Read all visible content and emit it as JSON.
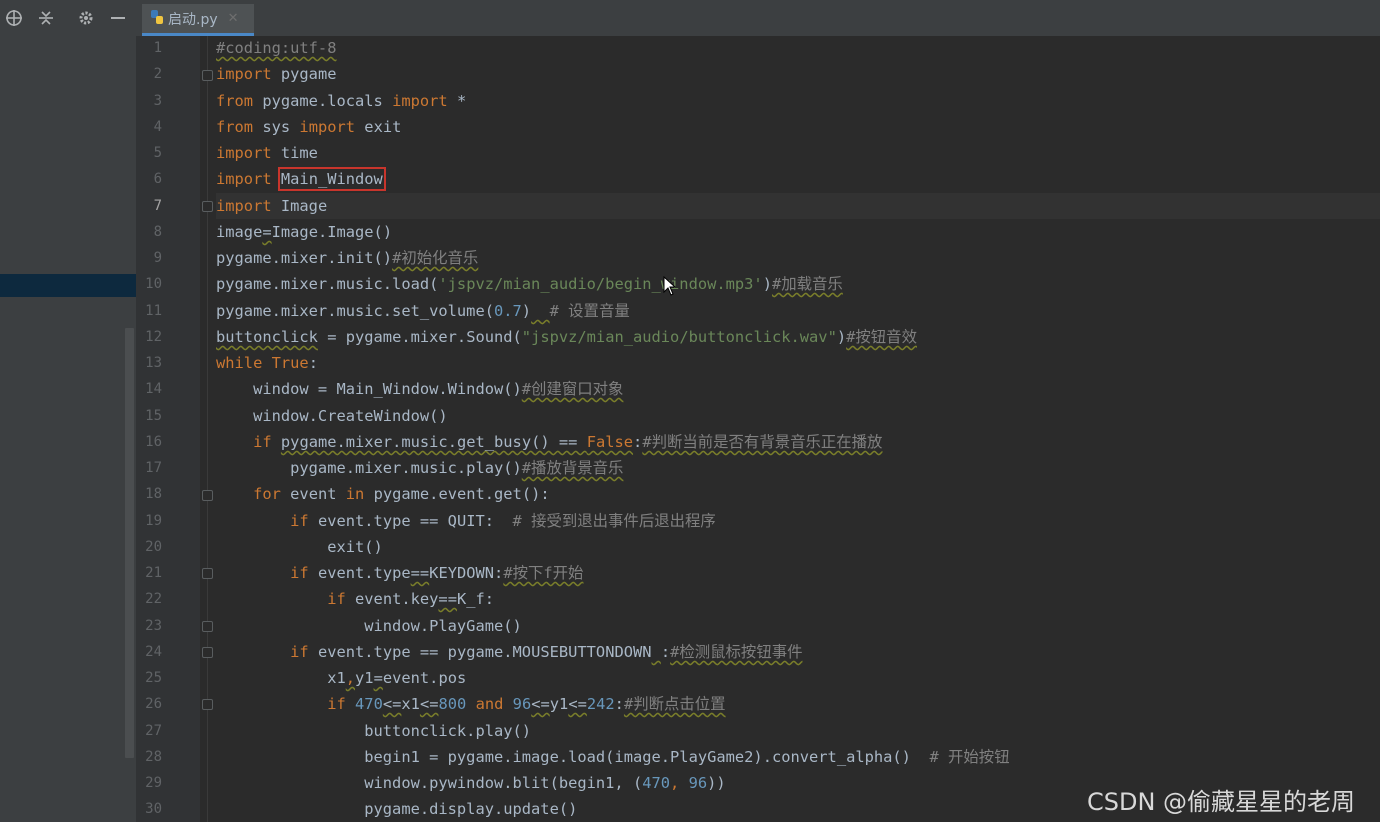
{
  "tab": {
    "filename": "启动.py"
  },
  "sidebar": {
    "icons": [
      "target-icon",
      "collapse-icon",
      "gear-icon",
      "minimize-icon"
    ]
  },
  "editor": {
    "current_line": 7,
    "lines": [
      {
        "n": "1"
      },
      {
        "n": "2"
      },
      {
        "n": "3"
      },
      {
        "n": "4"
      },
      {
        "n": "5"
      },
      {
        "n": "6"
      },
      {
        "n": "7"
      },
      {
        "n": "8"
      },
      {
        "n": "9"
      },
      {
        "n": "10"
      },
      {
        "n": "11"
      },
      {
        "n": "12"
      },
      {
        "n": "13"
      },
      {
        "n": "14"
      },
      {
        "n": "15"
      },
      {
        "n": "16"
      },
      {
        "n": "17"
      },
      {
        "n": "18"
      },
      {
        "n": "19"
      },
      {
        "n": "20"
      },
      {
        "n": "21"
      },
      {
        "n": "22"
      },
      {
        "n": "23"
      },
      {
        "n": "24"
      },
      {
        "n": "25"
      },
      {
        "n": "26"
      },
      {
        "n": "27"
      },
      {
        "n": "28"
      },
      {
        "n": "29"
      },
      {
        "n": "30"
      }
    ]
  },
  "code": {
    "l1": "#coding:utf-8",
    "l2a": "import",
    "l2b": " pygame",
    "l3a": "from",
    "l3b": " pygame.locals ",
    "l3c": "import",
    "l3d": " *",
    "l4a": "from",
    "l4b": " sys ",
    "l4c": "import",
    "l4d": " exit",
    "l5a": "import",
    "l5b": " time",
    "l6a": "import",
    "l6b": "Main_Window",
    "l7a": "import",
    "l7b": " Image",
    "l8a": "image",
    "l8b": "=",
    "l8c": "Image.Image()",
    "l9a": "pygame.mixer.init()",
    "l9b": "#初始化音乐",
    "l10a": "pygame.mixer.music.load(",
    "l10b": "'jspvz/mian_audio/begin_window.mp3'",
    "l10c": ")",
    "l10d": "#加载音乐",
    "l11a": "pygame.mixer.music.set_volume(",
    "l11b": "0.7",
    "l11c": ")",
    "l11d": "  ",
    "l11e": "# 设置音量",
    "l12a": "buttonclick",
    "l12b": " = pygame.mixer.Sound(",
    "l12c": "\"jspvz/mian_audio/buttonclick.wav\"",
    "l12d": ")",
    "l12e": "#按钮音效",
    "l13a": "while",
    "l13b": "True",
    "l13c": ":",
    "l14a": "    window = Main_Window.Window()",
    "l14b": "#创建窗口对象",
    "l15": "    window.CreateWindow()",
    "l16a": "    ",
    "l16b": "if",
    "l16c": " ",
    "l16d": "pygame.mixer.music.get_busy() == ",
    "l16e": "False",
    "l16f": ":",
    "l16g": "#判断当前是否有背景音乐正在播放",
    "l17a": "        pygame.mixer.music.play()",
    "l17b": "#播放背景音乐",
    "l18a": "    ",
    "l18b": "for",
    "l18c": " event ",
    "l18d": "in",
    "l18e": " pygame.event.get():",
    "l19a": "        ",
    "l19b": "if",
    "l19c": " event.type == QUIT:  ",
    "l19d": "# 接受到退出事件后退出程序",
    "l20": "            exit()",
    "l21a": "        ",
    "l21b": "if",
    "l21c": " event.type",
    "l21d": "==",
    "l21e": "KEYDOWN:",
    "l21f": "#按下f开始",
    "l22a": "            ",
    "l22b": "if",
    "l22c": " event.key",
    "l22d": "==",
    "l22e": "K_f:",
    "l23": "                window.PlayGame()",
    "l24a": "        ",
    "l24b": "if",
    "l24c": " event.type == pygame.MOUSEBUTTONDOWN",
    "l24d": " ",
    "l24e": ":",
    "l24f": "#检测鼠标按钮事件",
    "l25a": "            x1",
    "l25b": ",",
    "l25c": "y1",
    "l25d": "=",
    "l25e": "event.pos",
    "l26a": "            ",
    "l26b": "if",
    "l26c": " ",
    "l26d": "470",
    "l26e": "<=",
    "l26f": "x1",
    "l26g": "<=",
    "l26h": "800",
    "l26i": " ",
    "l26j": "and",
    "l26k": " ",
    "l26l": "96",
    "l26m": "<=",
    "l26n": "y1",
    "l26o": "<=",
    "l26p": "242",
    "l26q": ":",
    "l26r": "#判断点击位置",
    "l27": "                buttonclick.play()",
    "l28a": "                begin1 = pygame.image.load(image.PlayGame2).convert_alpha()  ",
    "l28b": "# 开始按钮",
    "l29a": "                window.pywindow.blit(begin1, (",
    "l29b": "470",
    "l29c": ", ",
    "l29d": "96",
    "l29e": "))",
    "l30": "                pygame.display.update()"
  },
  "watermark": "CSDN @偷藏星星的老周"
}
